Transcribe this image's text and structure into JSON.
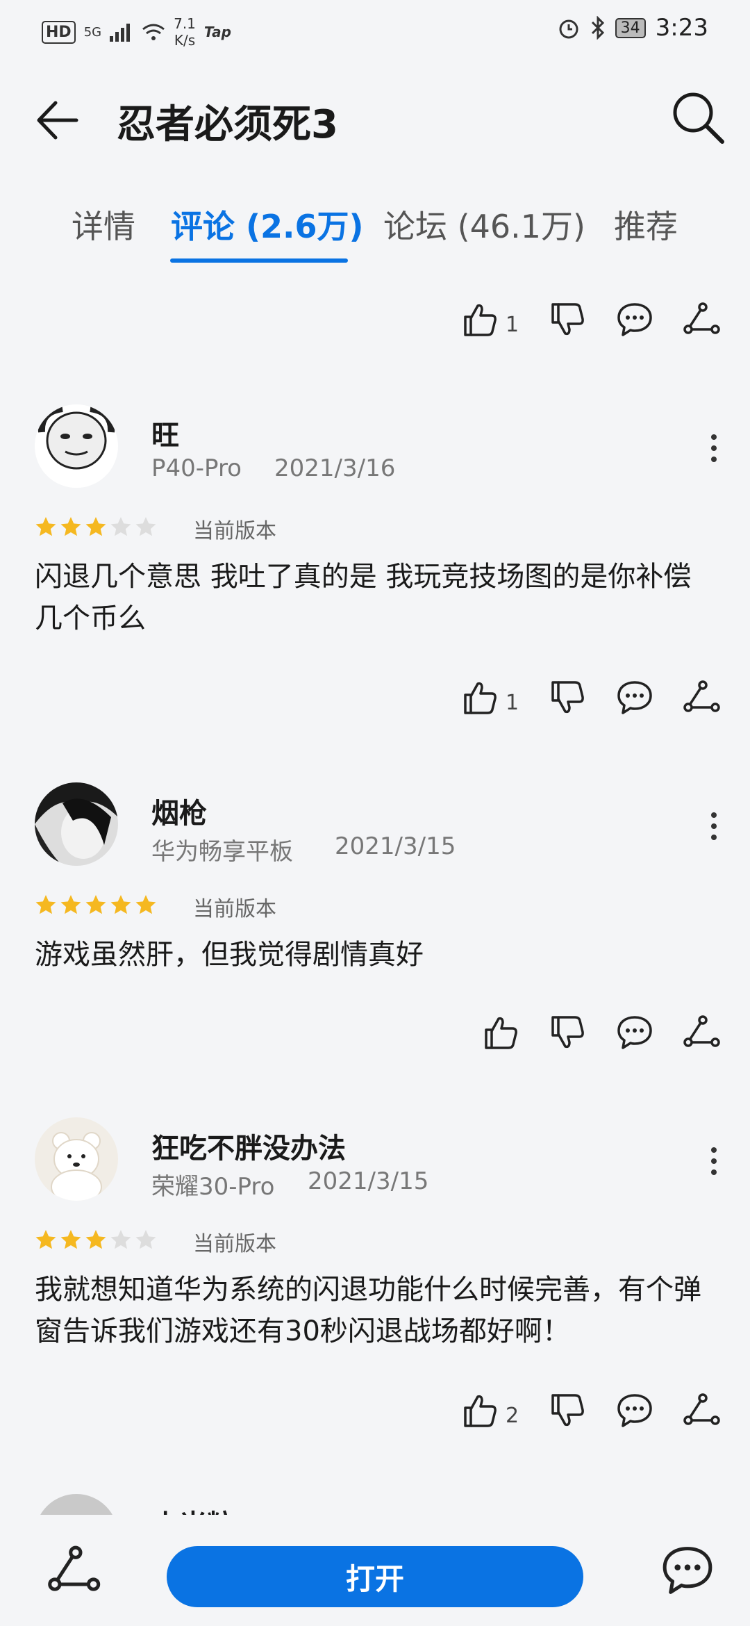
{
  "status_bar": {
    "hd": "HD",
    "signal": "5G",
    "net_speed": "7.1",
    "net_unit": "K/s",
    "tap": "Tap",
    "battery": "34",
    "time": "3:23"
  },
  "header": {
    "title": "忍者必须死3"
  },
  "tabs": [
    {
      "label": "详情",
      "active": false
    },
    {
      "label": "评论 (2.6万)",
      "active": true
    },
    {
      "label": "论坛 (46.1万)",
      "active": false
    },
    {
      "label": "推荐",
      "active": false
    }
  ],
  "top_actions": {
    "likes": "1"
  },
  "reviews": [
    {
      "user": "旺",
      "device": "P40-Pro",
      "date": "2021/3/16",
      "rating": 3,
      "version": "当前版本",
      "comment": "闪退几个意思 我吐了真的是  我玩竞技场图的是你补偿几个币么",
      "likes": "1"
    },
    {
      "user": "烟枪",
      "device": "华为畅享平板",
      "date": "2021/3/15",
      "rating": 5,
      "version": "当前版本",
      "comment": "游戏虽然肝，但我觉得剧情真好",
      "likes": ""
    },
    {
      "user": "狂吃不胖没办法",
      "device": "荣耀30-Pro",
      "date": "2021/3/15",
      "rating": 3,
      "version": "当前版本",
      "comment": "我就想知道华为系统的闪退功能什么时候完善，有个弹窗告诉我们游戏还有30秒闪退战场都好啊！",
      "likes": "2"
    },
    {
      "user": "小米粒"
    }
  ],
  "bottom_bar": {
    "open_label": "打开"
  },
  "colors": {
    "accent": "#0a73e3",
    "star_on": "#f5b820",
    "star_off": "#dddddd",
    "background": "#f4f5f7"
  },
  "icons": [
    "back-arrow-icon",
    "search-icon",
    "thumbs-up-icon",
    "thumbs-down-icon",
    "comment-icon",
    "share-icon",
    "more-icon",
    "star-icon"
  ]
}
